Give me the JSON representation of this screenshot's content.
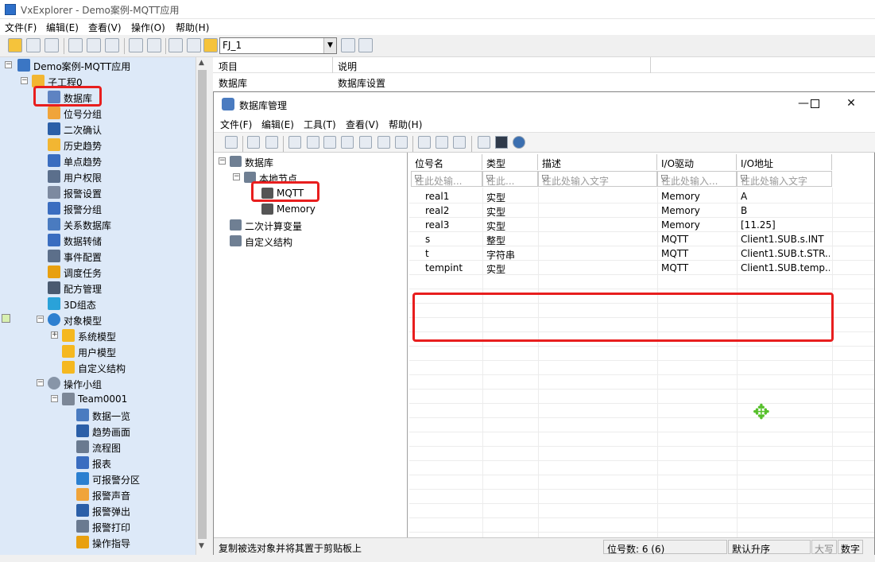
{
  "app": {
    "title": "VxExplorer - Demo案例-MQTT应用",
    "menu": [
      "文件(F)",
      "编辑(E)",
      "查看(V)",
      "操作(O)",
      "帮助(H)"
    ],
    "combo_value": "FJ_1"
  },
  "tree": {
    "root": "Demo案例-MQTT应用",
    "subproject": "子工程0",
    "items": [
      "数据库",
      "位号分组",
      "二次确认",
      "历史趋势",
      "单点趋势",
      "用户权限",
      "报警设置",
      "报警分组",
      "关系数据库",
      "数据转储",
      "事件配置",
      "调度任务",
      "配方管理",
      "3D组态"
    ],
    "object_model": "对象模型",
    "object_children": [
      "系统模型",
      "用户模型",
      "自定义结构"
    ],
    "op_group": "操作小组",
    "team": "Team0001",
    "team_children": [
      "数据一览",
      "趋势画面",
      "流程图",
      "报表",
      "可报警分区",
      "报警声音",
      "报警弹出",
      "报警打印",
      "操作指导"
    ]
  },
  "list": {
    "headers": [
      "项目",
      "说明"
    ],
    "row": [
      "数据库",
      "数据库设置"
    ]
  },
  "dialog": {
    "title": "数据库管理",
    "menu": [
      "文件(F)",
      "编辑(E)",
      "工具(T)",
      "查看(V)",
      "帮助(H)"
    ],
    "tree": {
      "root": "数据库",
      "local": "本地节点",
      "mqtt": "MQTT",
      "memory": "Memory",
      "secondary": "二次计算变量",
      "custom": "自定义结构"
    },
    "grid": {
      "headers": [
        "位号名",
        "类型",
        "描述",
        "I/O驱动",
        "I/O地址"
      ],
      "filters": [
        "在此处输...",
        "在此...",
        "在此处输入文字",
        "在此处输入...",
        "在此处输入文字"
      ],
      "rows": [
        [
          "real1",
          "实型",
          "",
          "Memory",
          "A"
        ],
        [
          "real2",
          "实型",
          "",
          "Memory",
          "B"
        ],
        [
          "real3",
          "实型",
          "",
          "Memory",
          "[11.25]"
        ],
        [
          "s",
          "整型",
          "",
          "MQTT",
          "Client1.SUB.s.INT"
        ],
        [
          "t",
          "字符串",
          "",
          "MQTT",
          "Client1.SUB.t.STR..."
        ],
        [
          "tempint",
          "实型",
          "",
          "MQTT",
          "Client1.SUB.temp..."
        ]
      ]
    },
    "status": {
      "message": "复制被选对象并将其置于剪贴板上",
      "count_label": "位号数: 6  (6)",
      "sort": "默认升序",
      "caps": "大写",
      "num": "数字"
    }
  }
}
